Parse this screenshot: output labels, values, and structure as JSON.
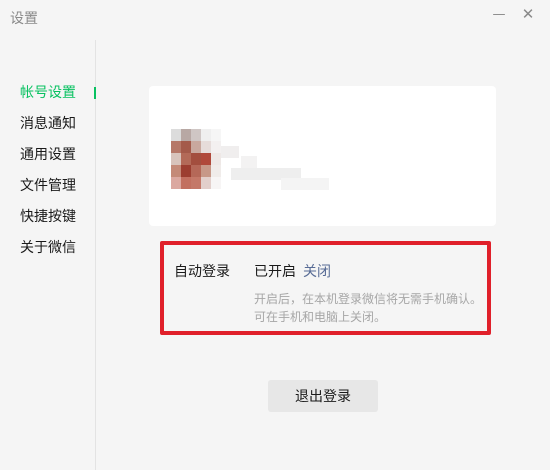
{
  "window": {
    "title": "设置",
    "minimize_glyph": "—",
    "close_glyph": "✕"
  },
  "sidebar": {
    "items": [
      {
        "label": "帐号设置",
        "active": true
      },
      {
        "label": "消息通知",
        "active": false
      },
      {
        "label": "通用设置",
        "active": false
      },
      {
        "label": "文件管理",
        "active": false
      },
      {
        "label": "快捷按键",
        "active": false
      },
      {
        "label": "关于微信",
        "active": false
      }
    ]
  },
  "account": {
    "avatar": "pixelated-avatar",
    "nickname": "pixelated-name"
  },
  "auto_login": {
    "label": "自动登录",
    "status": "已开启",
    "toggle_label": "关闭",
    "description_line1": "开启后，在本机登录微信将无需手机确认。",
    "description_line2": "可在手机和电脑上关闭。"
  },
  "logout_label": "退出登录",
  "colors": {
    "accent": "#07c160",
    "link": "#576b95",
    "highlight_border": "#e0202a",
    "background": "#f5f5f5",
    "card": "#ffffff"
  }
}
